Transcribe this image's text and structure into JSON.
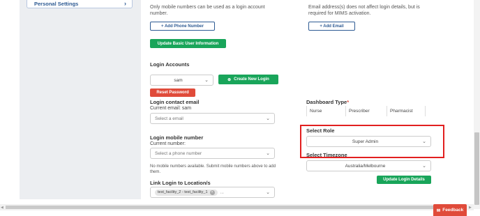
{
  "sidebar": {
    "item_label": "Personal Settings"
  },
  "help": {
    "login_numbers": "Only mobile numbers can be used as a login account number.",
    "email": "Email address(s) does not affect login details, but is required for MIMS activation."
  },
  "buttons": {
    "add_phone": "+ Add Phone Number",
    "add_email": "+ Add Email",
    "update_basic": "Update Basic User Information",
    "create_login": "Create New Login",
    "reset_password": "Reset Password",
    "update_login": "Update Login Details"
  },
  "login_accounts": {
    "title": "Login Accounts",
    "selected": "sam"
  },
  "login_email": {
    "title": "Login contact email",
    "current": "Current email: sam",
    "placeholder": "Select a email"
  },
  "login_mobile": {
    "title": "Login mobile number",
    "current": "Current number:",
    "placeholder": "Select a phone number",
    "note": "No mobile numbers available. Submit mobile numbers above to add them."
  },
  "locations": {
    "title": "Link Login to Location/s",
    "chip": "test_facility_2 - test_facility_1",
    "more": "..."
  },
  "dashboard": {
    "title": "Dashboard Type",
    "required_mark": "*",
    "options": [
      "Nurse",
      "Prescriber",
      "Pharmacist"
    ]
  },
  "role": {
    "title": "Select Role",
    "selected": "Super Admin"
  },
  "timezone": {
    "title": "Select Timezone",
    "selected": "Australia/Melbourne"
  },
  "feedback": {
    "label": "Feedback"
  },
  "colors": {
    "primary": "#2d5a93",
    "success": "#19a55a",
    "danger": "#e04b3a",
    "highlight": "#e21f1f"
  }
}
